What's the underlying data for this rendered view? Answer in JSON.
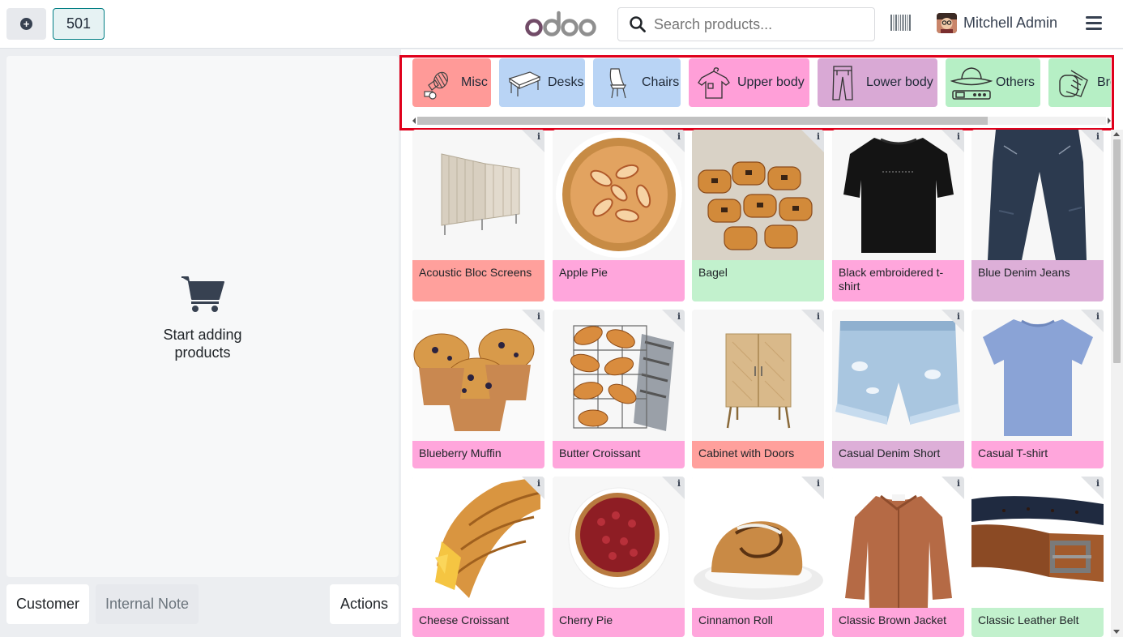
{
  "header": {
    "order_number": "501",
    "logo_text": "odoo",
    "search_placeholder": "Search products...",
    "user_name": "Mitchell Admin"
  },
  "order_panel": {
    "empty_message_line1": "Start adding",
    "empty_message_line2": "products",
    "buttons": {
      "customer": "Customer",
      "internal_note": "Internal Note",
      "actions": "Actions"
    }
  },
  "categories": [
    {
      "label": "Misc",
      "icon": "misc-icon",
      "color": "#ff9a98"
    },
    {
      "label": "Desks",
      "icon": "desk-icon",
      "color": "#b9d4f5"
    },
    {
      "label": "Chairs",
      "icon": "chair-icon",
      "color": "#b9d4f5"
    },
    {
      "label": "Upper body",
      "icon": "tshirt-icon",
      "color": "#ff9fd8"
    },
    {
      "label": "Lower body",
      "icon": "trousers-icon",
      "color": "#d9a9d5"
    },
    {
      "label": "Others",
      "icon": "hat-belt-icon",
      "color": "#b6efc5"
    },
    {
      "label": "Bread",
      "icon": "bread-icon",
      "color": "#b6efc5"
    }
  ],
  "products": [
    {
      "name": "Acoustic Bloc Screens",
      "color": "#ffa09c"
    },
    {
      "name": "Apple Pie",
      "color": "#ffa6dc"
    },
    {
      "name": "Bagel",
      "color": "#c2f1cd"
    },
    {
      "name": "Black embroidered t-shirt",
      "color": "#ffa6dc"
    },
    {
      "name": "Blue Denim Jeans",
      "color": "#ddafd8"
    },
    {
      "name": "Blueberry Muffin",
      "color": "#ffa6dc"
    },
    {
      "name": "Butter Croissant",
      "color": "#ffa6dc"
    },
    {
      "name": "Cabinet with Doors",
      "color": "#ffa09c"
    },
    {
      "name": "Casual Denim Short",
      "color": "#ddafd8"
    },
    {
      "name": "Casual T-shirt",
      "color": "#ffa6dc"
    },
    {
      "name": "Cheese Croissant",
      "color": "#ffa6dc"
    },
    {
      "name": "Cherry Pie",
      "color": "#ffa6dc"
    },
    {
      "name": "Cinnamon Roll",
      "color": "#ffa6dc"
    },
    {
      "name": "Classic Brown Jacket",
      "color": "#ffa6dc"
    },
    {
      "name": "Classic Leather Belt",
      "color": "#c2f1cd"
    }
  ],
  "colors": {
    "brand": "#714b67",
    "accent": "#017e84",
    "highlight_box": "#e0001b"
  }
}
